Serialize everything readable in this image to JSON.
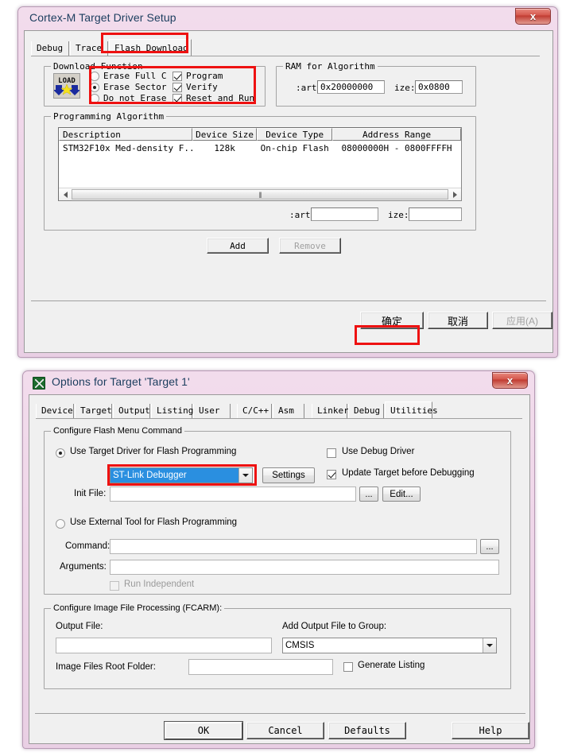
{
  "dialog1": {
    "title": "Cortex-M Target Driver Setup",
    "close_label": "x",
    "tabs": [
      {
        "label": "Debug",
        "active": false
      },
      {
        "label": "Trace",
        "active": false
      },
      {
        "label": "Flash Download",
        "active": true
      }
    ],
    "download_function": {
      "legend": "Download Function",
      "icon_label": "LOAD",
      "radios": [
        {
          "label": "Erase Full C",
          "checked": false
        },
        {
          "label": "Erase Sector",
          "checked": true
        },
        {
          "label": "Do not Erase",
          "checked": false
        }
      ],
      "checks": [
        {
          "label": "Program",
          "checked": true
        },
        {
          "label": "Verify",
          "checked": true
        },
        {
          "label": "Reset and Run",
          "checked": true
        }
      ]
    },
    "ram_for_algorithm": {
      "legend": "RAM for Algorithm",
      "start_label": ":art:",
      "start_value": "0x20000000",
      "size_label": "ize:",
      "size_value": "0x0800"
    },
    "programming_algorithm": {
      "legend": "Programming Algorithm",
      "columns": [
        "Description",
        "Device Size",
        "Device Type",
        "Address Range"
      ],
      "rows": [
        {
          "description": "STM32F10x Med-density F...",
          "device_size": "128k",
          "device_type": "On-chip Flash",
          "address_range": "08000000H - 0800FFFFH"
        }
      ],
      "start_label": ":art:",
      "start_value": "",
      "size_label": "ize:",
      "size_value": ""
    },
    "buttons": {
      "add": "Add",
      "remove": "Remove",
      "ok": "确定",
      "cancel": "取消",
      "apply": "应用(A)"
    }
  },
  "dialog2": {
    "title": "Options for Target 'Target 1'",
    "close_label": "x",
    "tabs": [
      {
        "label": "Device",
        "active": false
      },
      {
        "label": "Target",
        "active": false
      },
      {
        "label": "Output",
        "active": false
      },
      {
        "label": "Listing",
        "active": false
      },
      {
        "label": "User",
        "active": false
      },
      {
        "label": "C/C++",
        "active": false
      },
      {
        "label": "Asm",
        "active": false
      },
      {
        "label": "Linker",
        "active": false
      },
      {
        "label": "Debug",
        "active": false
      },
      {
        "label": "Utilities",
        "active": true
      }
    ],
    "flash_menu": {
      "legend": "Configure Flash Menu Command",
      "radio_target_driver": "Use Target Driver for Flash Programming",
      "radio_target_driver_checked": true,
      "driver_value": "ST-Link Debugger",
      "settings_label": "Settings",
      "check_debug_driver": "Use Debug Driver",
      "check_debug_driver_checked": false,
      "check_update_target": "Update Target before Debugging",
      "check_update_target_checked": true,
      "init_file_label": "Init File:",
      "init_file_value": "",
      "browse_label": "...",
      "edit_label": "Edit...",
      "radio_external_tool": "Use External Tool for Flash Programming",
      "radio_external_tool_checked": false,
      "command_label": "Command:",
      "command_value": "",
      "command_browse": "...",
      "arguments_label": "Arguments:",
      "arguments_value": "",
      "run_independent_label": "Run Independent",
      "run_independent_checked": false
    },
    "image_processing": {
      "legend": "Configure Image File Processing (FCARM):",
      "output_file_label": "Output File:",
      "output_file_value": "",
      "add_group_label": "Add Output File  to Group:",
      "add_group_value": "CMSIS",
      "root_folder_label": "Image Files Root Folder:",
      "root_folder_value": "",
      "generate_listing_label": "Generate Listing",
      "generate_listing_checked": false
    },
    "buttons": {
      "ok": "OK",
      "cancel": "Cancel",
      "defaults": "Defaults",
      "help": "Help"
    }
  },
  "colors": {
    "annotation": "#ee1111",
    "selection": "#2a8fe0",
    "window_glass": "#efd6e9",
    "face": "#f0f0f0"
  }
}
